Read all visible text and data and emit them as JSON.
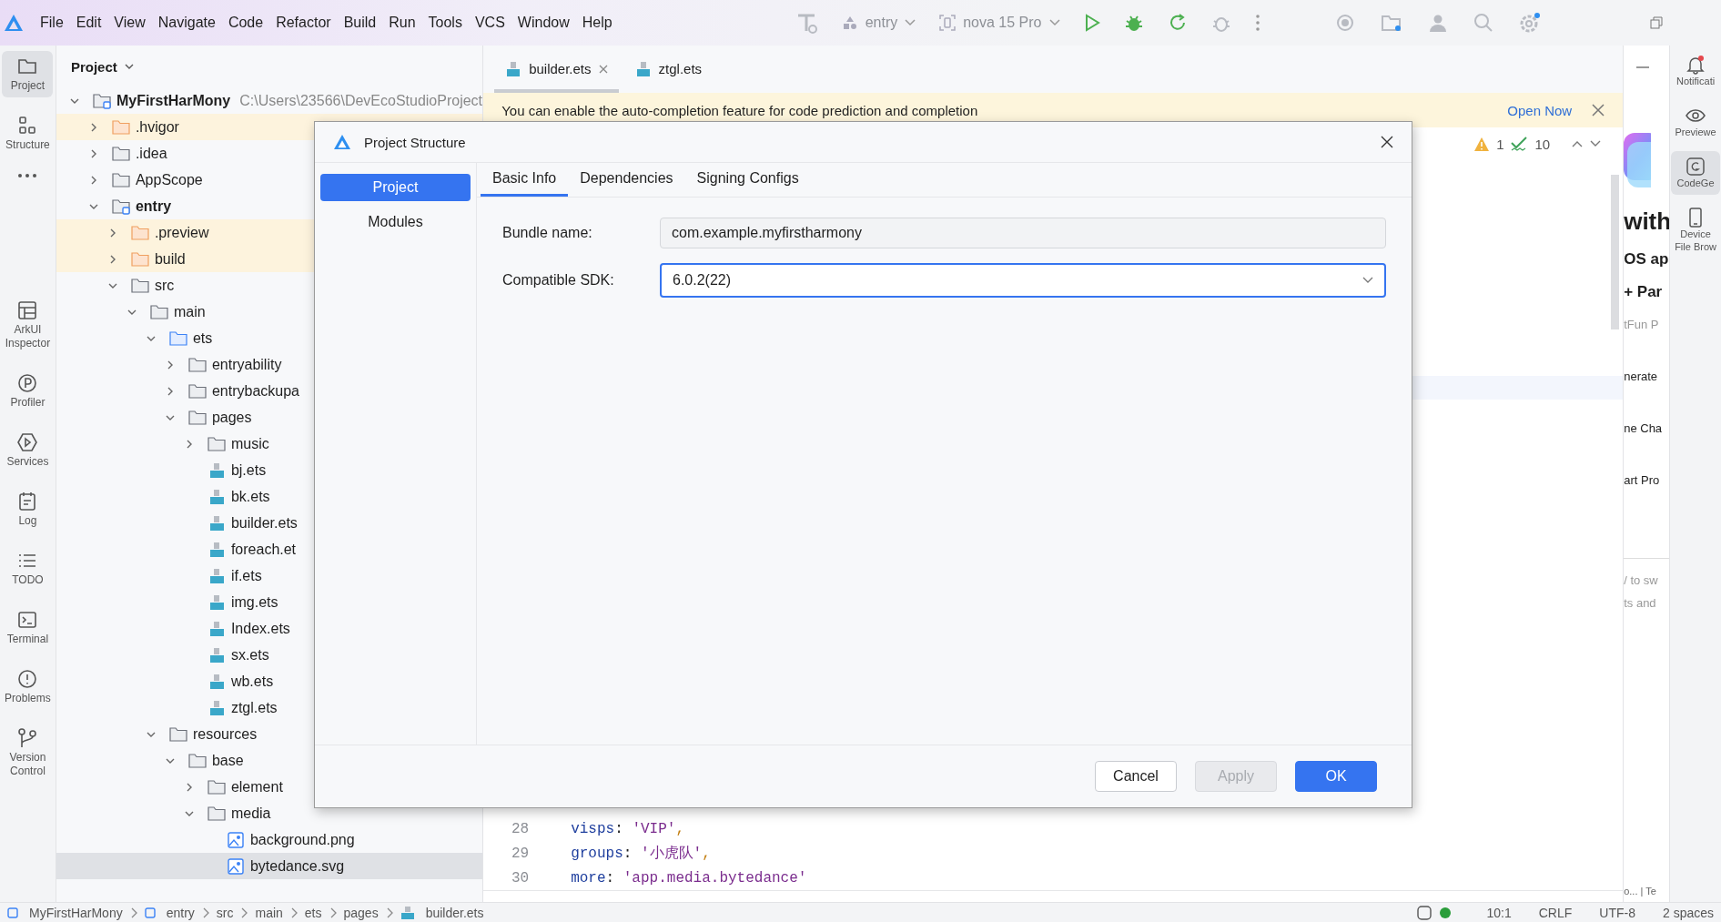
{
  "menu": [
    "File",
    "Edit",
    "View",
    "Navigate",
    "Code",
    "Refactor",
    "Build",
    "Run",
    "Tools",
    "VCS",
    "Window",
    "Help"
  ],
  "toolbar": {
    "module": "entry",
    "device": "nova 15 Pro"
  },
  "left_tools": [
    {
      "label": "Project",
      "selected": true
    },
    {
      "label": "Structure",
      "selected": false
    },
    {
      "selected": false
    },
    {
      "label": "ArkUI Inspector",
      "selected": false
    },
    {
      "label": "Profiler",
      "selected": false
    },
    {
      "label": "Services",
      "selected": false
    },
    {
      "label": "Log",
      "selected": false
    },
    {
      "label": "TODO",
      "selected": false
    },
    {
      "label": "Terminal",
      "selected": false
    },
    {
      "label": "Problems",
      "selected": false
    },
    {
      "label": "Version Control",
      "selected": false
    }
  ],
  "project_panel": {
    "title": "Project",
    "tree": [
      {
        "name": "MyFirstHarMony",
        "kind": "module",
        "bold": true,
        "path": "C:\\Users\\23566\\DevEcoStudioProject",
        "expanded": true,
        "selected": false,
        "children": [
          {
            "name": ".hvigor",
            "kind": "folder",
            "excluded": true,
            "expanded": false,
            "selected": false
          },
          {
            "name": ".idea",
            "kind": "folder",
            "excluded": false,
            "expanded": false,
            "selected": false
          },
          {
            "name": "AppScope",
            "kind": "folder",
            "excluded": false,
            "expanded": false,
            "selected": false
          },
          {
            "name": "entry",
            "kind": "module",
            "bold": true,
            "expanded": true,
            "selected": false,
            "children": [
              {
                "name": ".preview",
                "kind": "folder",
                "excluded": true,
                "expanded": false,
                "selected": false
              },
              {
                "name": "build",
                "kind": "folder",
                "excluded": true,
                "expanded": false,
                "selected": false
              },
              {
                "name": "src",
                "kind": "folder",
                "excluded": false,
                "expanded": true,
                "selected": false,
                "children": [
                  {
                    "name": "main",
                    "kind": "folder",
                    "excluded": false,
                    "expanded": true,
                    "selected": false,
                    "children": [
                      {
                        "name": "ets",
                        "kind": "source",
                        "excluded": false,
                        "expanded": true,
                        "selected": false,
                        "children": [
                          {
                            "name": "entryability",
                            "kind": "folder",
                            "excluded": false,
                            "expanded": false,
                            "selected": false
                          },
                          {
                            "name": "entrybackupa",
                            "kind": "folder",
                            "excluded": false,
                            "expanded": false,
                            "selected": false
                          },
                          {
                            "name": "pages",
                            "kind": "folder",
                            "excluded": false,
                            "expanded": true,
                            "selected": false,
                            "children": [
                              {
                                "name": "music",
                                "kind": "folder",
                                "excluded": false,
                                "expanded": false,
                                "selected": false
                              },
                              {
                                "name": "bj.ets",
                                "kind": "ets",
                                "selected": false
                              },
                              {
                                "name": "bk.ets",
                                "kind": "ets",
                                "selected": false
                              },
                              {
                                "name": "builder.ets",
                                "kind": "ets",
                                "selected": false
                              },
                              {
                                "name": "foreach.et",
                                "kind": "ets",
                                "selected": false
                              },
                              {
                                "name": "if.ets",
                                "kind": "ets",
                                "selected": false
                              },
                              {
                                "name": "img.ets",
                                "kind": "ets",
                                "selected": false
                              },
                              {
                                "name": "Index.ets",
                                "kind": "ets",
                                "selected": false
                              },
                              {
                                "name": "sx.ets",
                                "kind": "ets",
                                "selected": false
                              },
                              {
                                "name": "wb.ets",
                                "kind": "ets",
                                "selected": false
                              },
                              {
                                "name": "ztgl.ets",
                                "kind": "ets",
                                "selected": false
                              }
                            ]
                          }
                        ]
                      },
                      {
                        "name": "resources",
                        "kind": "folder",
                        "excluded": false,
                        "expanded": true,
                        "selected": false,
                        "children": [
                          {
                            "name": "base",
                            "kind": "folder",
                            "excluded": false,
                            "expanded": true,
                            "selected": false,
                            "children": [
                              {
                                "name": "element",
                                "kind": "folder",
                                "excluded": false,
                                "expanded": false,
                                "selected": false
                              },
                              {
                                "name": "media",
                                "kind": "folder",
                                "excluded": false,
                                "expanded": true,
                                "selected": false,
                                "children": [
                                  {
                                    "name": "background.png",
                                    "kind": "image",
                                    "selected": false
                                  },
                                  {
                                    "name": "bytedance.svg",
                                    "kind": "image",
                                    "selected": true
                                  }
                                ]
                              }
                            ]
                          }
                        ]
                      }
                    ]
                  }
                ]
              }
            ]
          }
        ]
      }
    ]
  },
  "editor": {
    "tabs": [
      {
        "label": "builder.ets",
        "selected": true
      },
      {
        "label": "ztgl.ets",
        "selected": false
      }
    ],
    "banner": {
      "message": "You can enable the auto-completion feature for code prediction and completion",
      "action": "Open Now"
    },
    "inspections": {
      "warnings": "1",
      "checks": "10"
    },
    "code": [
      {
        "number": "28",
        "tokens": [
          {
            "text": "visps",
            "kind": "key"
          },
          {
            "text": ": ",
            "kind": "plain"
          },
          {
            "text": "'VIP'",
            "kind": "string"
          },
          {
            "text": ",",
            "kind": "punct"
          }
        ]
      },
      {
        "number": "29",
        "tokens": [
          {
            "text": "groups",
            "kind": "key"
          },
          {
            "text": ": ",
            "kind": "plain"
          },
          {
            "text": "'小虎队'",
            "kind": "string"
          },
          {
            "text": ",",
            "kind": "punct"
          }
        ]
      },
      {
        "number": "30",
        "tokens": [
          {
            "text": "more",
            "kind": "key"
          },
          {
            "text": ": ",
            "kind": "plain"
          },
          {
            "text": "'app.media.bytedance'",
            "kind": "string"
          }
        ]
      }
    ]
  },
  "codegen_panel": {
    "texts": [
      {
        "text": "with",
        "kind": "heading"
      },
      {
        "text": "OS ap",
        "kind": "subheading"
      },
      {
        "text": "+ Par",
        "kind": "subheading"
      },
      {
        "text": "tFun P",
        "kind": "muted"
      },
      {
        "text": "nerate",
        "kind": "item"
      },
      {
        "text": "ne Cha",
        "kind": "item"
      },
      {
        "text": "art Pro",
        "kind": "item"
      }
    ],
    "input_hints": [
      "/ to sw",
      "ts and"
    ],
    "footer": "o... | Te"
  },
  "right_tools": [
    {
      "label": "Notificati",
      "selected": false
    },
    {
      "label": "Previewe",
      "selected": false
    },
    {
      "label": "CodeGe",
      "selected": true
    },
    {
      "label": "Device File Brow",
      "selected": false
    }
  ],
  "dialog": {
    "title": "Project Structure",
    "nav": [
      {
        "label": "Project",
        "selected": true
      },
      {
        "label": "Modules",
        "selected": false
      }
    ],
    "tabs": [
      {
        "label": "Basic Info",
        "selected": true
      },
      {
        "label": "Dependencies",
        "selected": false
      },
      {
        "label": "Signing Configs",
        "selected": false
      }
    ],
    "fields": [
      {
        "label": "Bundle name:",
        "value": "com.example.myfirstharmony",
        "kind": "text",
        "focused": false
      },
      {
        "label": "Compatible SDK:",
        "value": "6.0.2(22)",
        "kind": "dropdown",
        "focused": true
      }
    ],
    "buttons": [
      {
        "label": "Cancel",
        "kind": "secondary",
        "disabled": false
      },
      {
        "label": "Apply",
        "kind": "secondary",
        "disabled": true
      },
      {
        "label": "OK",
        "kind": "primary",
        "disabled": false
      }
    ]
  },
  "status_bar": {
    "breadcrumb": [
      {
        "label": "MyFirstHarMony",
        "kind": "module"
      },
      {
        "label": "entry",
        "kind": "module"
      },
      {
        "label": "src",
        "kind": "folder"
      },
      {
        "label": "main",
        "kind": "folder"
      },
      {
        "label": "ets",
        "kind": "folder"
      },
      {
        "label": "pages",
        "kind": "folder"
      },
      {
        "label": "builder.ets",
        "kind": "ets"
      }
    ],
    "items": [
      "10:1",
      "CRLF",
      "UTF-8",
      "2 spaces"
    ]
  }
}
